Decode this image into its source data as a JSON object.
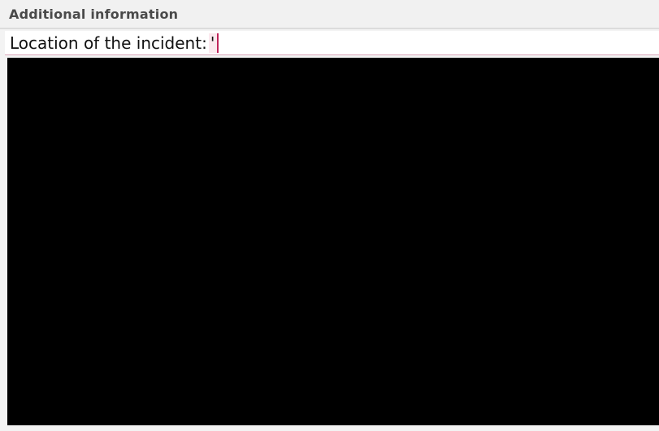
{
  "section": {
    "title": "Additional information"
  },
  "incident_location": {
    "label": "Location of the incident:",
    "value": "'"
  },
  "colors": {
    "accent": "#c0245a",
    "content_background": "#000000",
    "panel_background": "#f3f3f3"
  }
}
